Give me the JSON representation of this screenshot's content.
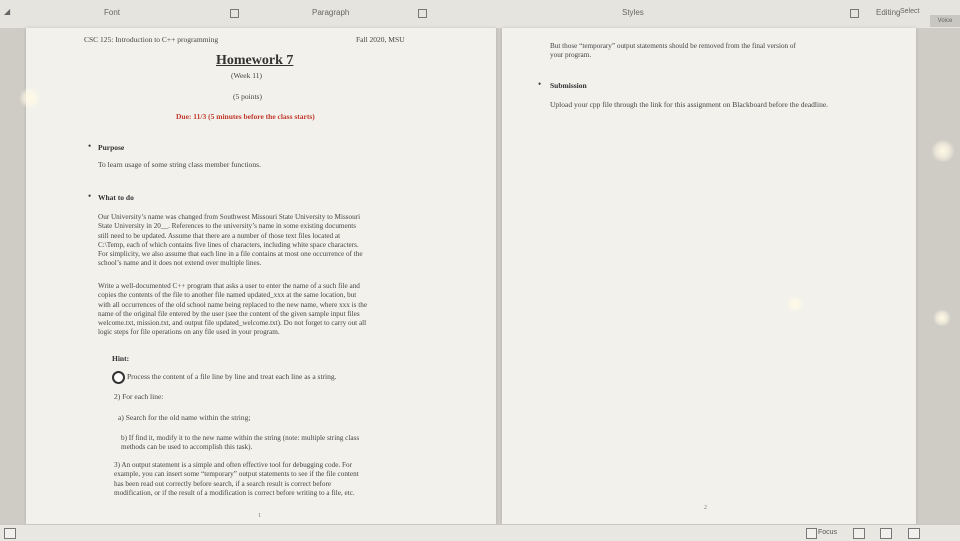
{
  "ribbon": {
    "font_label": "Font",
    "paragraph_label": "Paragraph",
    "styles_label": "Styles",
    "editing_label": "Editing",
    "voice_label": "Voice",
    "select_label": "Select"
  },
  "page1": {
    "course": "CSC 125: Introduction to C++ programming",
    "term": "Fall 2020, MSU",
    "title": "Homework 7",
    "week": "(Week 11)",
    "points": "(5 points)",
    "due": "Due: 11/3 (5 minutes before the class starts)",
    "purpose_heading": "Purpose",
    "purpose_text": "To learn usage of some string class member functions.",
    "whattodo_heading": "What to do",
    "para1": [
      "Our University’s name was changed from Southwest Missouri State University to Missouri",
      "State University in 20__. References to the university’s name in some existing documents",
      "still need to be updated. Assume that there are a number of those text files located at",
      "C:\\Temp, each of which contains five lines of characters, including white space characters.",
      "For simplicity, we also assume that each line in a file contains at most one occurrence of the",
      "school’s name and it does not extend over multiple lines."
    ],
    "para2": [
      "Write a well-documented C++ program that asks a user to enter the name of a such file and",
      "copies the contents of the file to another file named updated_xxx at the same location, but",
      "with all occurrences of the old school name being replaced to the new name, where xxx is the",
      "name of the original file entered by the user (see the content of the given sample input files",
      "welcome.txt, mission.txt, and output file updated_welcome.txt). Do not forget to carry out all",
      "logic steps for file operations on any file used in your program."
    ],
    "hint": "Hint:",
    "hint1": "Process the content of a file line by line and treat each line as a string.",
    "hint2": "2) For each line:",
    "hint2a": "a) Search for the old name within the string;",
    "hint2b": [
      "b) If find it, modify it to the new name within the string (note: multiple string class",
      "methods can be used to accomplish this task)."
    ],
    "hint3": [
      "3) An output statement is a simple and often effective tool for debugging code. For",
      "example, you can insert some “temporary” output statements to see if the file content",
      "has been read out correctly before search, if a search result is correct before",
      "modification, or if the result of a modification is correct before writing to a file, etc."
    ],
    "page_number": "1"
  },
  "page2": {
    "note": [
      "But those “temporary” output statements should be removed from the final version of",
      "your program."
    ],
    "submission_heading": "Submission",
    "submission_text": "Upload your cpp file through the link for this assignment on Blackboard before the deadline.",
    "page_number": "2"
  },
  "statusbar": {
    "focus_label": "Focus"
  },
  "colors": {
    "accent_red": "#c0392b",
    "page_bg": "#f3f1ec"
  }
}
